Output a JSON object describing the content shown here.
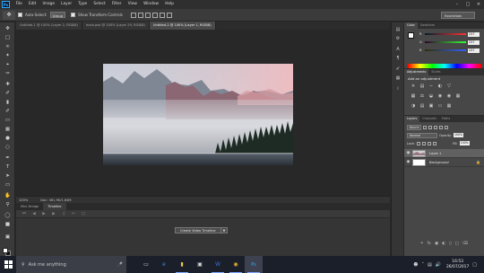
{
  "app": {
    "logo": "Ps"
  },
  "menu": [
    "File",
    "Edit",
    "Image",
    "Layer",
    "Type",
    "Select",
    "Filter",
    "View",
    "Window",
    "Help"
  ],
  "window_controls": [
    "minimize",
    "maximize",
    "close"
  ],
  "options_bar": {
    "auto_select_label": "Auto-Select:",
    "auto_select_target": "Group",
    "show_transform_label": "Show Transform Controls",
    "workspace": "Essentials"
  },
  "document_tabs": [
    {
      "label": "Untitled-1 @ 100% (Layer 2, RGB/8)",
      "active": false
    },
    {
      "label": "main.psd @ 100% (Layer 29, RGB/8)",
      "active": false
    },
    {
      "label": "Untitled-2 @ 100% (Layer 1, RGB/8)",
      "active": true
    }
  ],
  "status_bar": {
    "zoom": "100%",
    "doc_info": "Doc: 461,9K/1,64M"
  },
  "timeline": {
    "tabs": [
      {
        "label": "Mini Bridge",
        "active": false
      },
      {
        "label": "Timeline",
        "active": true
      }
    ],
    "create_button": "Create Video Timeline"
  },
  "color_panel": {
    "tabs": [
      {
        "label": "Color",
        "active": true
      },
      {
        "label": "Swatches",
        "active": false
      }
    ],
    "sliders": [
      {
        "channel": "R",
        "value": "237",
        "color": "#ff0000"
      },
      {
        "channel": "G",
        "value": "237",
        "color": "#00c000"
      },
      {
        "channel": "B",
        "value": "237",
        "color": "#0050ff"
      }
    ]
  },
  "adjustments_panel": {
    "tabs": [
      {
        "label": "Adjustments",
        "active": true
      },
      {
        "label": "Styles",
        "active": false
      }
    ],
    "title": "Add an adjustment"
  },
  "layers_panel": {
    "tabs": [
      {
        "label": "Layers",
        "active": true
      },
      {
        "label": "Channels",
        "active": false
      },
      {
        "label": "Paths",
        "active": false
      }
    ],
    "filter": "Kind",
    "blend_mode": "Normal",
    "opacity_label": "Opacity:",
    "opacity": "100%",
    "lock_label": "Lock:",
    "fill_label": "Fill:",
    "fill": "100%",
    "layers": [
      {
        "name": "Layer 1",
        "selected": true,
        "italic": false
      },
      {
        "name": "Background",
        "selected": false,
        "italic": true
      }
    ]
  },
  "taskbar": {
    "search_placeholder": "Ask me anything",
    "time": "16:53",
    "date": "26/07/2017"
  }
}
